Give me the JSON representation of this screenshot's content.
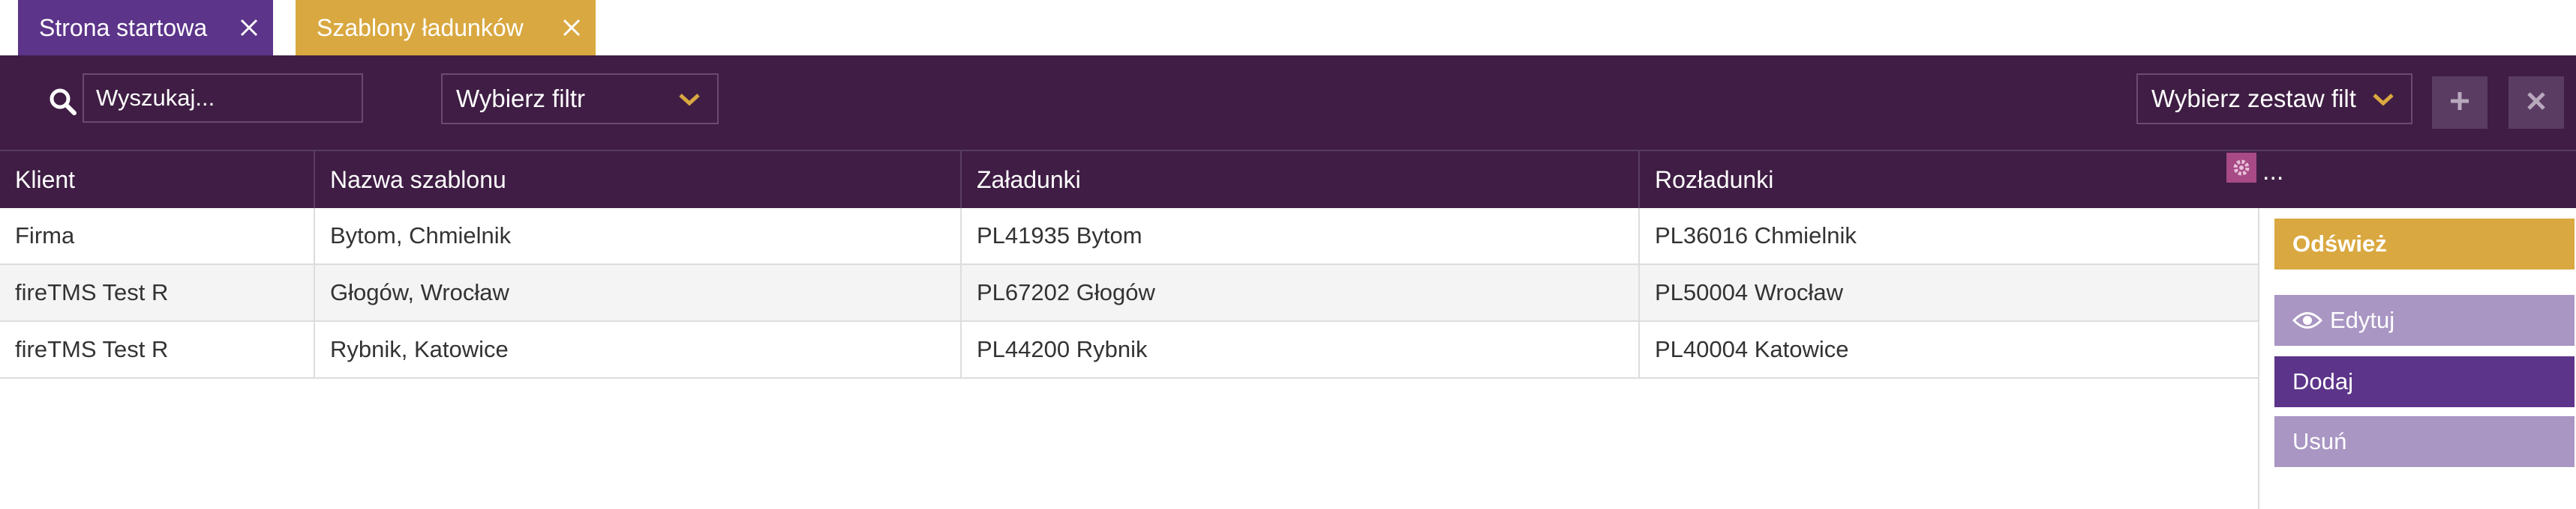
{
  "tabs": [
    {
      "label": "Strona startowa"
    },
    {
      "label": "Szablony ładunków"
    }
  ],
  "toolbar": {
    "search_placeholder": "Wyszukaj...",
    "filter_select": "Wybierz filtr",
    "filterset_select": "Wybierz zestaw filt",
    "add_icon": "plus-icon",
    "clear_icon": "close-icon"
  },
  "grid": {
    "columns": [
      "Klient",
      "Nazwa szablonu",
      "Załadunki",
      "Rozładunki"
    ],
    "more_label": "...",
    "rows": [
      [
        "Firma",
        "Bytom, Chmielnik",
        "PL41935 Bytom",
        "PL36016 Chmielnik"
      ],
      [
        "fireTMS Test R",
        "Głogów, Wrocław",
        "PL67202 Głogów",
        "PL50004 Wrocław"
      ],
      [
        "fireTMS Test R",
        "Rybnik, Katowice",
        "PL44200 Rybnik",
        "PL40004 Katowice"
      ]
    ]
  },
  "side_panel": {
    "refresh": "Odśwież",
    "edit": "Edytuj",
    "add": "Dodaj",
    "delete": "Usuń"
  },
  "colors": {
    "header_bg": "#3f1d44",
    "accent_gold": "#d9a840",
    "accent_purple": "#5c3489",
    "muted_purple": "#a996c3"
  }
}
